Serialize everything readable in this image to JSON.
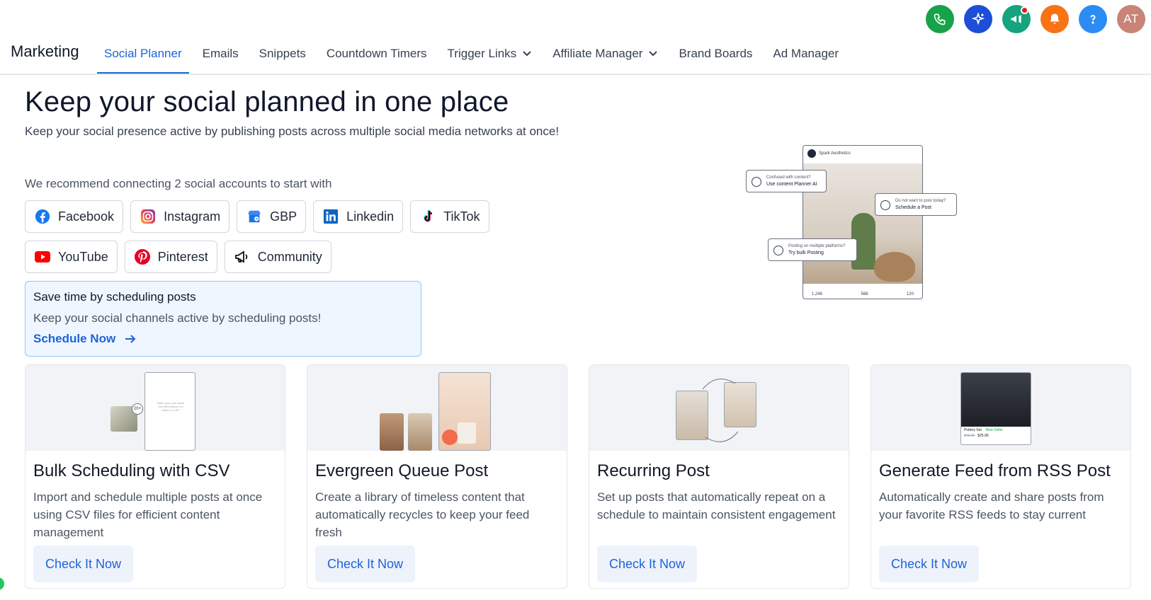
{
  "header": {
    "icons": [
      {
        "name": "phone-icon",
        "color": "#16a34a"
      },
      {
        "name": "sparkle-icon",
        "color": "#1d4ed8"
      },
      {
        "name": "megaphone-icon",
        "color": "#16a37f"
      },
      {
        "name": "bell-icon",
        "color": "#f97316"
      },
      {
        "name": "help-icon",
        "color": "#2b8cf3"
      }
    ],
    "avatar": {
      "initials": "AT",
      "color": "#c88476"
    }
  },
  "nav": {
    "title": "Marketing",
    "tabs": [
      {
        "label": "Social Planner",
        "active": true
      },
      {
        "label": "Emails"
      },
      {
        "label": "Snippets"
      },
      {
        "label": "Countdown Timers"
      },
      {
        "label": "Trigger Links",
        "dropdown": true
      },
      {
        "label": "Affiliate Manager",
        "dropdown": true
      },
      {
        "label": "Brand Boards"
      },
      {
        "label": "Ad Manager"
      }
    ]
  },
  "hero": {
    "title": "Keep your social planned in one place",
    "subtitle": "Keep your social presence active by publishing posts across multiple social media networks at once!",
    "recommend": "We recommend connecting 2 social accounts to start with"
  },
  "social_accounts": {
    "row1": [
      "Facebook",
      "Instagram",
      "GBP",
      "Linkedin",
      "TikTok"
    ],
    "row2": [
      "YouTube",
      "Pinterest",
      "Community"
    ]
  },
  "schedule_box": {
    "title": "Save time by scheduling posts",
    "description": "Keep your social channels active by scheduling posts!",
    "link": "Schedule Now"
  },
  "illustration": {
    "account": "Spark Aesthetics",
    "callout1_small": "Confused with content?",
    "callout1_main": "Use content Planner AI",
    "callout2_small": "Do not want to post today?",
    "callout2_main": "Schedule a Post",
    "callout3_small": "Posting on multiple platforms?",
    "callout3_main": "Try bulk Posting",
    "likes": "1,246",
    "comments": "568",
    "shares": "120"
  },
  "cards": [
    {
      "title": "Bulk Scheduling with CSV",
      "description": "Import and schedule multiple posts at once using CSV files for efficient content management",
      "button": "Check It Now"
    },
    {
      "title": "Evergreen Queue Post",
      "description": "Create a library of timeless content that automatically recycles to keep your feed fresh",
      "button": "Check It Now"
    },
    {
      "title": "Recurring Post",
      "description": "Set up posts that automatically repeat on a schedule to maintain consistent engagement",
      "button": "Check It Now"
    },
    {
      "title": "Generate Feed from RSS Post",
      "description": "Automatically create and share posts from your favorite RSS feeds to stay current",
      "button": "Check It Now"
    }
  ],
  "card_art": {
    "bulk_badge": "20+",
    "bulk_caption": "Make your post stand out with photos or a video or a GIF",
    "rss_product": "Pottery Set",
    "rss_badge": "Best Seller",
    "rss_old_price": "$49.99",
    "rss_price": "$25.99"
  }
}
